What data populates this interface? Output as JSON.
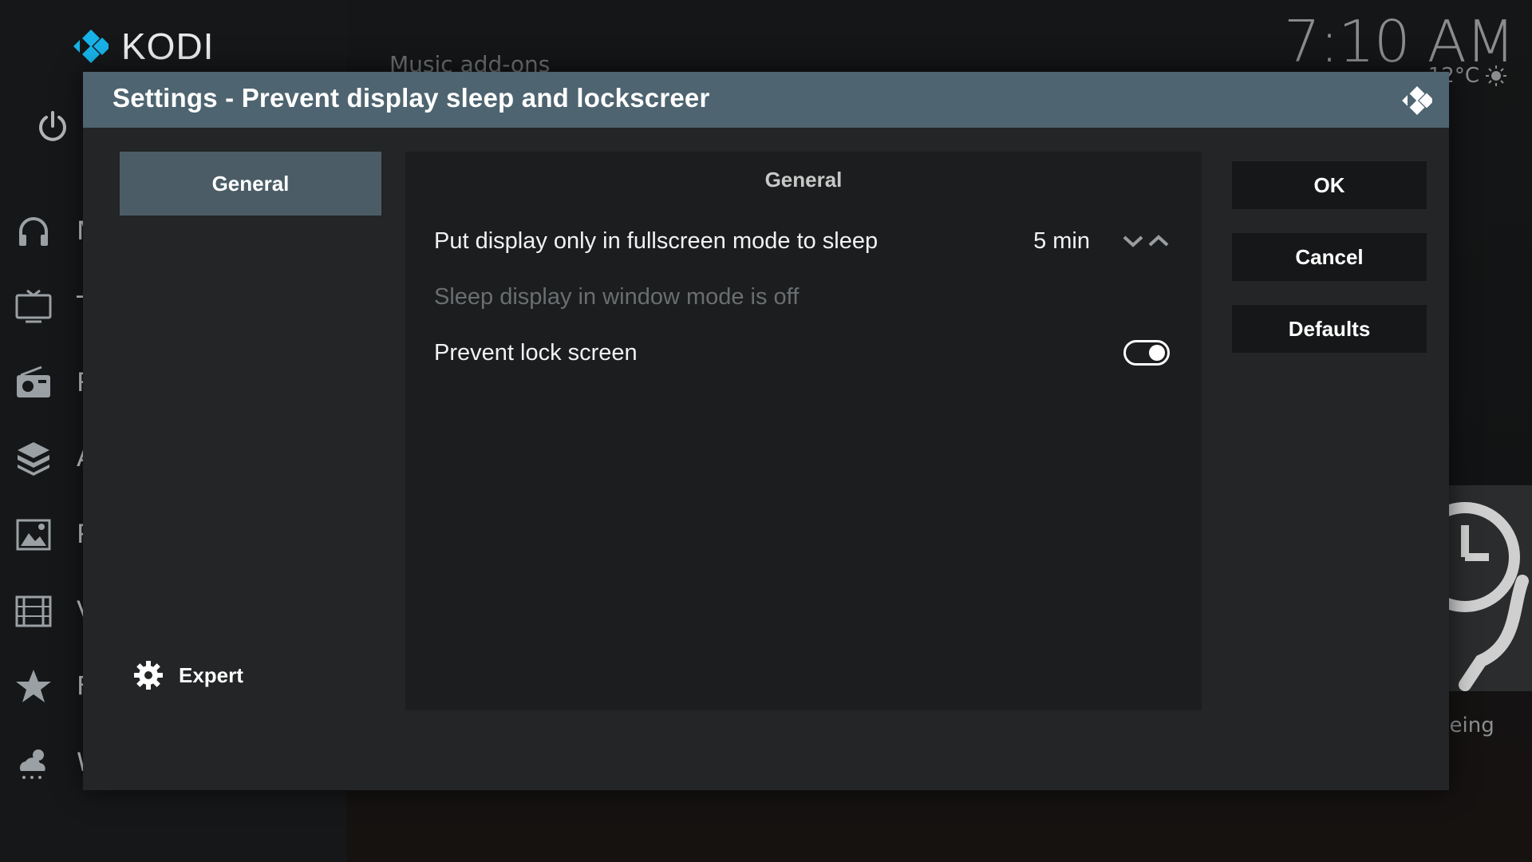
{
  "background": {
    "app_name": "KODI",
    "section_title": "Music add-ons",
    "clock": "7:10 AM",
    "temperature": "12°C",
    "tile_caption": "being",
    "sidebar_items": [
      {
        "icon": "headphones-icon",
        "label": "Music"
      },
      {
        "icon": "tv-icon",
        "label": "TV"
      },
      {
        "icon": "radio-icon",
        "label": "Radio"
      },
      {
        "icon": "addons-box-icon",
        "label": "Add-ons"
      },
      {
        "icon": "pictures-icon",
        "label": "Pictures"
      },
      {
        "icon": "videos-film-icon",
        "label": "Videos"
      },
      {
        "icon": "favourites-star-icon",
        "label": "Favourites"
      },
      {
        "icon": "weather-icon",
        "label": "Weather"
      }
    ]
  },
  "dialog": {
    "title": "Settings - Prevent display sleep and lockscreer",
    "categories": [
      {
        "label": "General",
        "selected": true
      }
    ],
    "expert_label": "Expert",
    "panel_heading": "General",
    "settings": [
      {
        "label": "Put display only in fullscreen mode to sleep",
        "value": "5 min",
        "type": "spinner",
        "enabled": true
      },
      {
        "label": "Sleep display in window mode is off",
        "type": "info",
        "enabled": false
      },
      {
        "label": "Prevent lock screen",
        "type": "toggle",
        "state": "on",
        "enabled": true
      }
    ],
    "buttons": {
      "ok": "OK",
      "cancel": "Cancel",
      "defaults": "Defaults"
    }
  },
  "colors": {
    "header": "#4e6470",
    "dialog_bg": "#232526",
    "panel_bg": "#1b1d1e",
    "selected_category": "#4b5c66",
    "button_bg": "#151718"
  }
}
